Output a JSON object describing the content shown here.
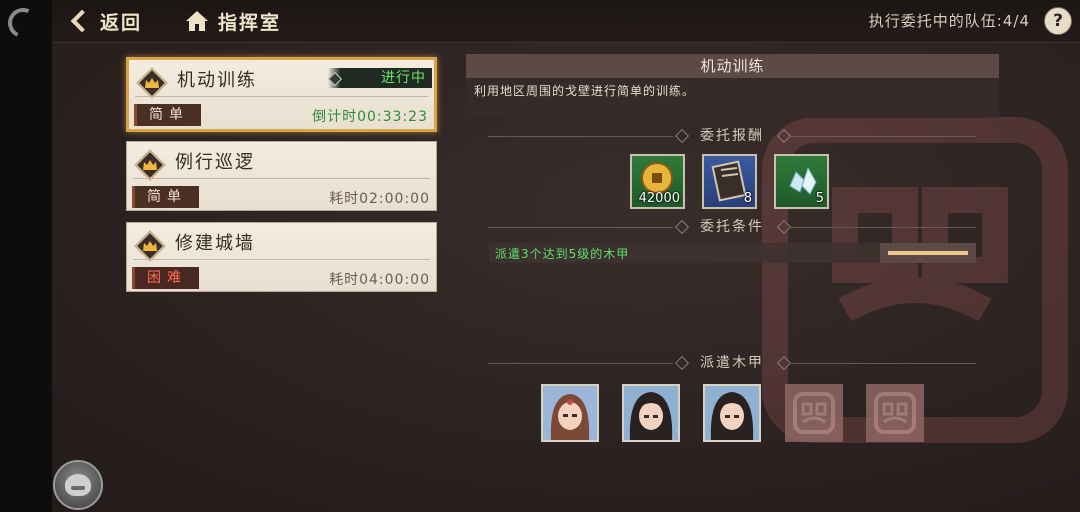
{
  "topbar": {
    "back_label": "返回",
    "home_label": "指挥室",
    "queue_label": "执行委托中的队伍:",
    "queue_value": "4/4",
    "help_symbol": "?"
  },
  "missions": [
    {
      "name": "机动训练",
      "difficulty": "简单",
      "time_label": "倒计时00:33:23",
      "status": "进行中",
      "selected": true
    },
    {
      "name": "例行巡逻",
      "difficulty": "简单",
      "time_label": "耗时02:00:00"
    },
    {
      "name": "修建城墙",
      "difficulty": "困难",
      "time_label": "耗时04:00:00"
    }
  ],
  "detail": {
    "title": "机动训练",
    "description": "利用地区周围的戈壁进行简单的训练。",
    "rewards_header": "委托报酬",
    "rewards": [
      {
        "icon": "gold-coin-icon",
        "count": "42000"
      },
      {
        "icon": "manual-book-icon",
        "count": "8"
      },
      {
        "icon": "crystal-ore-icon",
        "count": "5"
      }
    ],
    "conditions_header": "委托条件",
    "condition_text": "派遣3个达到5级的木甲",
    "condition_progress": 1.0,
    "dispatch_header": "派遣木甲"
  },
  "colors": {
    "accent_gold": "#d9a441",
    "status_green": "#6fe26a",
    "hard_red": "#ff6b55"
  }
}
